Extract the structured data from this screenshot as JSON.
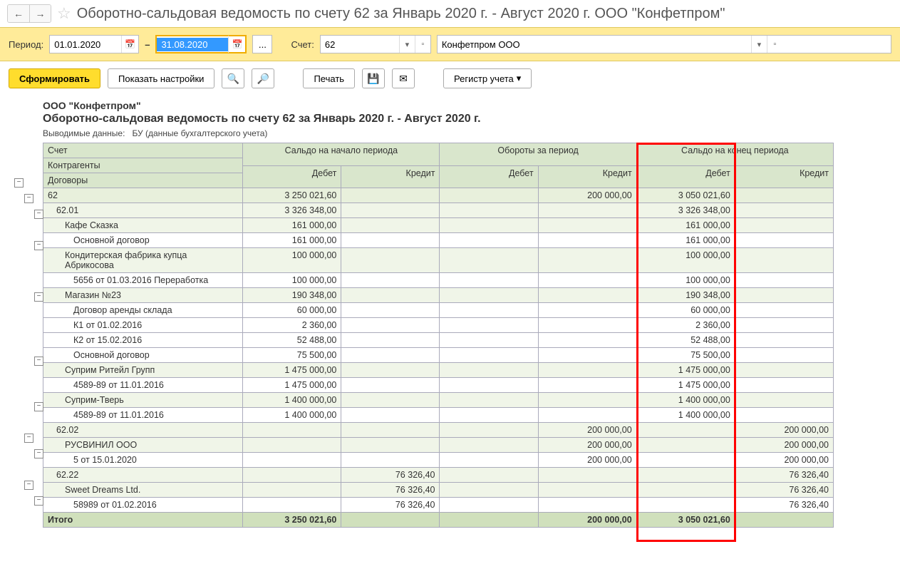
{
  "header": {
    "title": "Оборотно-сальдовая ведомость по счету 62 за Январь 2020 г. - Август 2020 г. ООО \"Конфетпром\""
  },
  "period": {
    "label": "Период:",
    "from": "01.01.2020",
    "to": "31.08.2020",
    "account_label": "Счет:",
    "account": "62",
    "org": "Конфетпром ООО",
    "ellipsis": "..."
  },
  "actions": {
    "generate": "Сформировать",
    "settings": "Показать настройки",
    "print": "Печать",
    "register": "Регистр учета"
  },
  "report": {
    "company": "ООО \"Конфетпром\"",
    "title": "Оборотно-сальдовая ведомость по счету 62 за Январь 2020 г. - Август 2020 г.",
    "subtitle_label": "Выводимые данные:",
    "subtitle_value": "БУ (данные бухгалтерского учета)"
  },
  "columns": {
    "account": "Счет",
    "counterparties": "Контрагенты",
    "contracts": "Договоры",
    "start_balance": "Сальдо на начало периода",
    "turnover": "Обороты за период",
    "end_balance": "Сальдо на конец периода",
    "debit": "Дебет",
    "credit": "Кредит"
  },
  "rows": [
    {
      "type": "acct",
      "indent": 0,
      "label": "62",
      "sd": "3 250 021,60",
      "sc": "",
      "td": "",
      "tc": "200 000,00",
      "ed": "3 050 021,60",
      "ec": ""
    },
    {
      "type": "sub",
      "indent": 1,
      "label": "62.01",
      "sd": "3 326 348,00",
      "sc": "",
      "td": "",
      "tc": "",
      "ed": "3 326 348,00",
      "ec": ""
    },
    {
      "type": "sub",
      "indent": 2,
      "label": "Кафе Сказка",
      "sd": "161 000,00",
      "sc": "",
      "td": "",
      "tc": "",
      "ed": "161 000,00",
      "ec": ""
    },
    {
      "type": "data",
      "indent": 3,
      "label": "Основной договор",
      "sd": "161 000,00",
      "sc": "",
      "td": "",
      "tc": "",
      "ed": "161 000,00",
      "ec": ""
    },
    {
      "type": "sub",
      "indent": 2,
      "label": "Кондитерская фабрика купца Абрикосова",
      "sd": "100 000,00",
      "sc": "",
      "td": "",
      "tc": "",
      "ed": "100 000,00",
      "ec": ""
    },
    {
      "type": "data",
      "indent": 3,
      "label": "5656 от 01.03.2016 Переработка",
      "sd": "100 000,00",
      "sc": "",
      "td": "",
      "tc": "",
      "ed": "100 000,00",
      "ec": ""
    },
    {
      "type": "sub",
      "indent": 2,
      "label": "Магазин №23",
      "sd": "190 348,00",
      "sc": "",
      "td": "",
      "tc": "",
      "ed": "190 348,00",
      "ec": ""
    },
    {
      "type": "data",
      "indent": 3,
      "label": "Договор аренды склада",
      "sd": "60 000,00",
      "sc": "",
      "td": "",
      "tc": "",
      "ed": "60 000,00",
      "ec": ""
    },
    {
      "type": "data",
      "indent": 3,
      "label": "К1 от 01.02.2016",
      "sd": "2 360,00",
      "sc": "",
      "td": "",
      "tc": "",
      "ed": "2 360,00",
      "ec": ""
    },
    {
      "type": "data",
      "indent": 3,
      "label": "К2 от 15.02.2016",
      "sd": "52 488,00",
      "sc": "",
      "td": "",
      "tc": "",
      "ed": "52 488,00",
      "ec": ""
    },
    {
      "type": "data",
      "indent": 3,
      "label": "Основной договор",
      "sd": "75 500,00",
      "sc": "",
      "td": "",
      "tc": "",
      "ed": "75 500,00",
      "ec": ""
    },
    {
      "type": "sub",
      "indent": 2,
      "label": "Суприм Ритейл Групп",
      "sd": "1 475 000,00",
      "sc": "",
      "td": "",
      "tc": "",
      "ed": "1 475 000,00",
      "ec": ""
    },
    {
      "type": "data",
      "indent": 3,
      "label": "4589-89 от 11.01.2016",
      "sd": "1 475 000,00",
      "sc": "",
      "td": "",
      "tc": "",
      "ed": "1 475 000,00",
      "ec": ""
    },
    {
      "type": "sub",
      "indent": 2,
      "label": "Суприм-Тверь",
      "sd": "1 400 000,00",
      "sc": "",
      "td": "",
      "tc": "",
      "ed": "1 400 000,00",
      "ec": ""
    },
    {
      "type": "data",
      "indent": 3,
      "label": "4589-89 от 11.01.2016",
      "sd": "1 400 000,00",
      "sc": "",
      "td": "",
      "tc": "",
      "ed": "1 400 000,00",
      "ec": ""
    },
    {
      "type": "sub",
      "indent": 1,
      "label": "62.02",
      "sd": "",
      "sc": "",
      "td": "",
      "tc": "200 000,00",
      "ed": "",
      "ec": "200 000,00"
    },
    {
      "type": "sub",
      "indent": 2,
      "label": "РУСВИНИЛ ООО",
      "sd": "",
      "sc": "",
      "td": "",
      "tc": "200 000,00",
      "ed": "",
      "ec": "200 000,00"
    },
    {
      "type": "data",
      "indent": 3,
      "label": "5 от 15.01.2020",
      "sd": "",
      "sc": "",
      "td": "",
      "tc": "200 000,00",
      "ed": "",
      "ec": "200 000,00"
    },
    {
      "type": "sub",
      "indent": 1,
      "label": "62.22",
      "sd": "",
      "sc": "76 326,40",
      "td": "",
      "tc": "",
      "ed": "",
      "ec": "76 326,40"
    },
    {
      "type": "sub",
      "indent": 2,
      "label": "Sweet Dreams Ltd.",
      "sd": "",
      "sc": "76 326,40",
      "td": "",
      "tc": "",
      "ed": "",
      "ec": "76 326,40"
    },
    {
      "type": "data",
      "indent": 3,
      "label": "58989 от 01.02.2016",
      "sd": "",
      "sc": "76 326,40",
      "td": "",
      "tc": "",
      "ed": "",
      "ec": "76 326,40"
    },
    {
      "type": "total",
      "indent": 0,
      "label": "Итого",
      "sd": "3 250 021,60",
      "sc": "",
      "td": "",
      "tc": "200 000,00",
      "ed": "3 050 021,60",
      "ec": ""
    }
  ]
}
